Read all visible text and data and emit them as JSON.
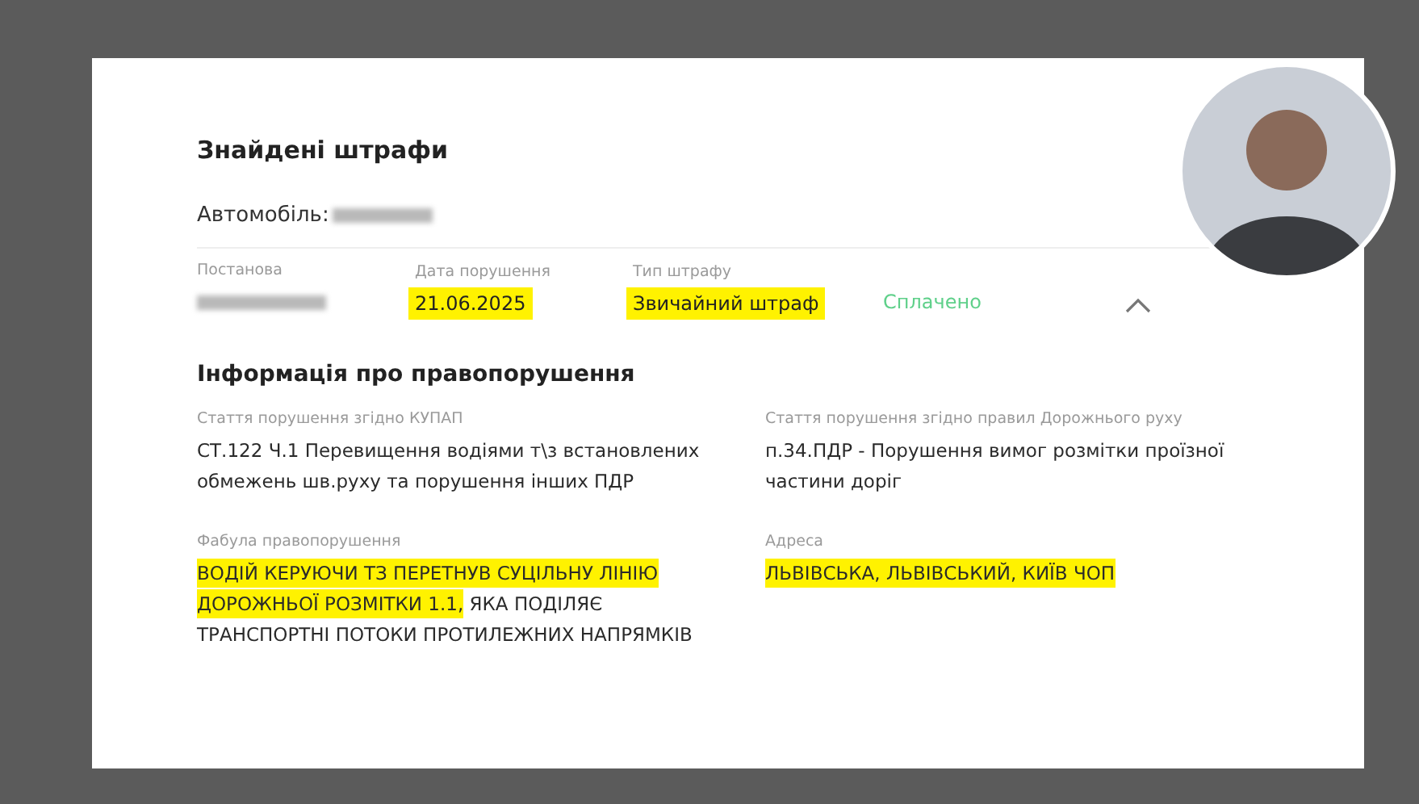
{
  "title": "Знайдені штрафи",
  "vehicle": {
    "label": "Автомобіль:"
  },
  "fine": {
    "expanded": true,
    "status": "Сплачено",
    "fields": [
      {
        "label": "Постанова",
        "redacted": true
      },
      {
        "label": "Дата порушення",
        "value": "21.06.2025",
        "highlighted": true
      },
      {
        "label": "Тип штрафу",
        "value": "Звичайний штраф",
        "highlighted": true
      }
    ]
  },
  "info": {
    "title": "Інформація про правопорушення",
    "fields": [
      {
        "label": "Стаття порушення згідно КУПАП",
        "segments": [
          {
            "text": "СТ.122 Ч.1 Перевищення водіями т\\з встановлених обмежень шв.руху та порушення інших ПДР",
            "highlighted": false
          }
        ]
      },
      {
        "label": "Стаття порушення згідно правил Дорожнього руху",
        "segments": [
          {
            "text": "п.34.ПДР - Порушення вимог розмітки проїзної частини доріг",
            "highlighted": false
          }
        ]
      },
      {
        "label": "Фабула правопорушення",
        "segments": [
          {
            "text": "ВОДІЙ КЕРУЮЧИ ТЗ ПЕРЕТНУВ СУЦІЛЬНУ ЛІНІЮ ДОРОЖНЬОЇ РОЗМІТКИ 1.1,",
            "highlighted": true
          },
          {
            "text": " ЯКА ПОДІЛЯЄ ТРАНСПОРТНІ ПОТОКИ ПРОТИЛЕЖНИХ НАПРЯМКІВ",
            "highlighted": false
          }
        ]
      },
      {
        "label": "Адреса",
        "segments": [
          {
            "text": "ЛЬВІВСЬКА, ЛЬВІВСЬКИЙ, КИЇВ ЧОП",
            "highlighted": true
          }
        ]
      }
    ]
  }
}
